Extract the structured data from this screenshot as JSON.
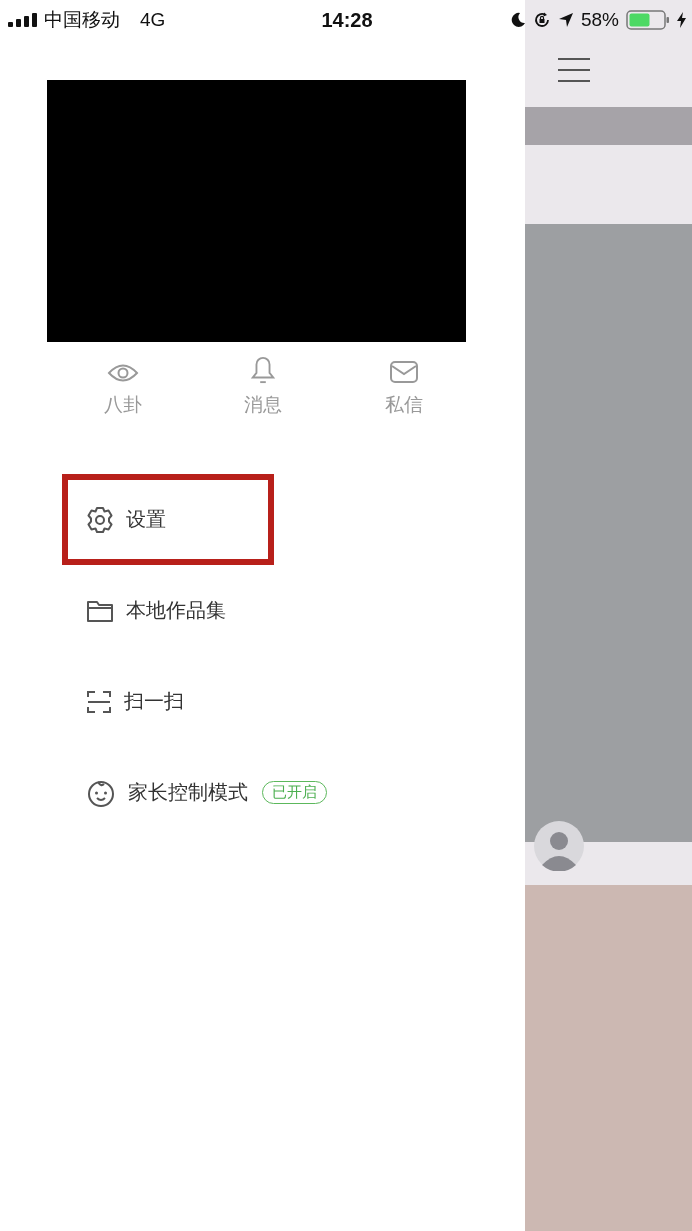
{
  "status_bar": {
    "carrier": "中国移动",
    "network": "4G",
    "time": "14:28",
    "battery": "58%"
  },
  "drawer": {
    "quick_actions": [
      {
        "label": "八卦",
        "kind": "eye"
      },
      {
        "label": "消息",
        "kind": "bell"
      },
      {
        "label": "私信",
        "kind": "mail"
      }
    ],
    "menu": [
      {
        "label": "设置",
        "kind": "gear",
        "highlighted": true
      },
      {
        "label": "本地作品集",
        "kind": "folder",
        "highlighted": false
      },
      {
        "label": "扫一扫",
        "kind": "scan",
        "highlighted": false
      },
      {
        "label": "家长控制模式",
        "kind": "face",
        "highlighted": false,
        "badge": "已开启"
      }
    ]
  }
}
